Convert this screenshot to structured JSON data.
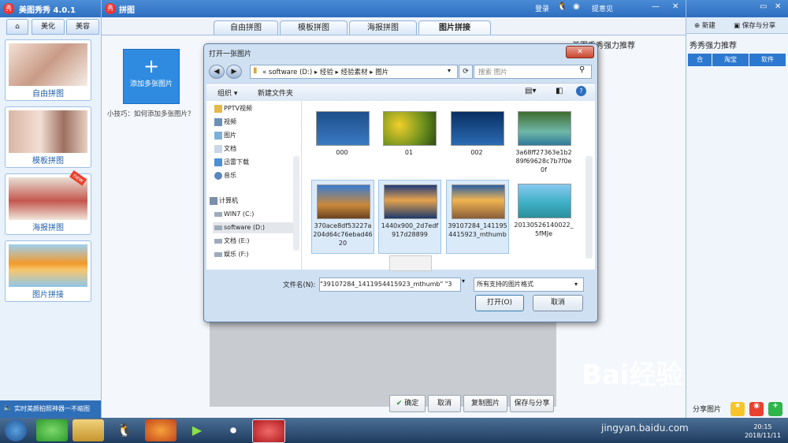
{
  "meitu": {
    "title": "美图秀秀 4.0.1",
    "logo_text": "秀",
    "tabs": [
      "美化",
      "美容"
    ],
    "side_cards": [
      {
        "label": "自由拼图"
      },
      {
        "label": "模板拼图"
      },
      {
        "label": "海报拼图",
        "badge": "new"
      },
      {
        "label": "图片拼接"
      }
    ],
    "bottom_text": "实时美颜拍照神器一不缩图"
  },
  "collage": {
    "title": "拼图",
    "tabs": [
      "自由拼图",
      "模板拼图",
      "海报拼图",
      "图片拼接"
    ],
    "active_tab": "图片拼接",
    "add_button": "添加多张图片",
    "tip": "小技巧：如何添加多张图片？",
    "top_links": [
      "登录",
      "提意见"
    ],
    "bottom_buttons": [
      "确定",
      "取消",
      "复制图片",
      "保存与分享"
    ]
  },
  "right_panel": {
    "top_buttons": [
      "新建",
      "保存与分享"
    ],
    "heading": "秀秀强力推荐",
    "heading_partial": "美图秀秀强力推荐",
    "tabs": [
      "合",
      "淘宝",
      "软件"
    ],
    "share_text": "分享图片"
  },
  "dialog": {
    "title": "打开一张图片",
    "breadcrumb": [
      "«",
      "software (D:)",
      "经验",
      "经验素材",
      "图片"
    ],
    "search_placeholder": "搜索 图片",
    "toolbar": {
      "organize": "组织 ▾",
      "new_folder": "新建文件夹"
    },
    "nav_items": [
      {
        "label": "PPTV视频",
        "icon": "folder-icon"
      },
      {
        "label": "视频",
        "icon": "video-library-icon"
      },
      {
        "label": "图片",
        "icon": "picture-library-icon"
      },
      {
        "label": "文档",
        "icon": "document-library-icon"
      },
      {
        "label": "迅雷下载",
        "icon": "download-icon"
      },
      {
        "label": "音乐",
        "icon": "music-icon"
      },
      {
        "label": "计算机",
        "icon": "computer-icon"
      },
      {
        "label": "WIN7 (C:)",
        "icon": "drive-icon"
      },
      {
        "label": "software (D:)",
        "icon": "drive-icon"
      },
      {
        "label": "文档 (E:)",
        "icon": "drive-icon"
      },
      {
        "label": "娱乐 (F:)",
        "icon": "drive-icon"
      }
    ],
    "files": [
      {
        "name": "000",
        "selected": false
      },
      {
        "name": "01",
        "selected": false
      },
      {
        "name": "002",
        "selected": false
      },
      {
        "name": "3a68ff27363e1b289f69628c7b7f0e0f",
        "selected": false
      },
      {
        "name": "370ace8df53227a204d64c76ebad4620",
        "selected": true
      },
      {
        "name": "1440x900_2d7edf917d28899",
        "selected": true
      },
      {
        "name": "39107284_1411954415923_mthumb",
        "selected": true
      },
      {
        "name": "20130526140022_5fMJe",
        "selected": false
      }
    ],
    "filename_label": "文件名(N):",
    "filename_value": "\"39107284_1411954415923_mthumb\" \"3",
    "filter_value": "所有支持的图片格式",
    "open_button": "打开(O)",
    "cancel_button": "取消"
  },
  "taskbar": {
    "time": "20:15",
    "date": "2018/11/11"
  },
  "watermark": {
    "main": "Bai经验",
    "sub": "jingyan.baidu.com"
  }
}
